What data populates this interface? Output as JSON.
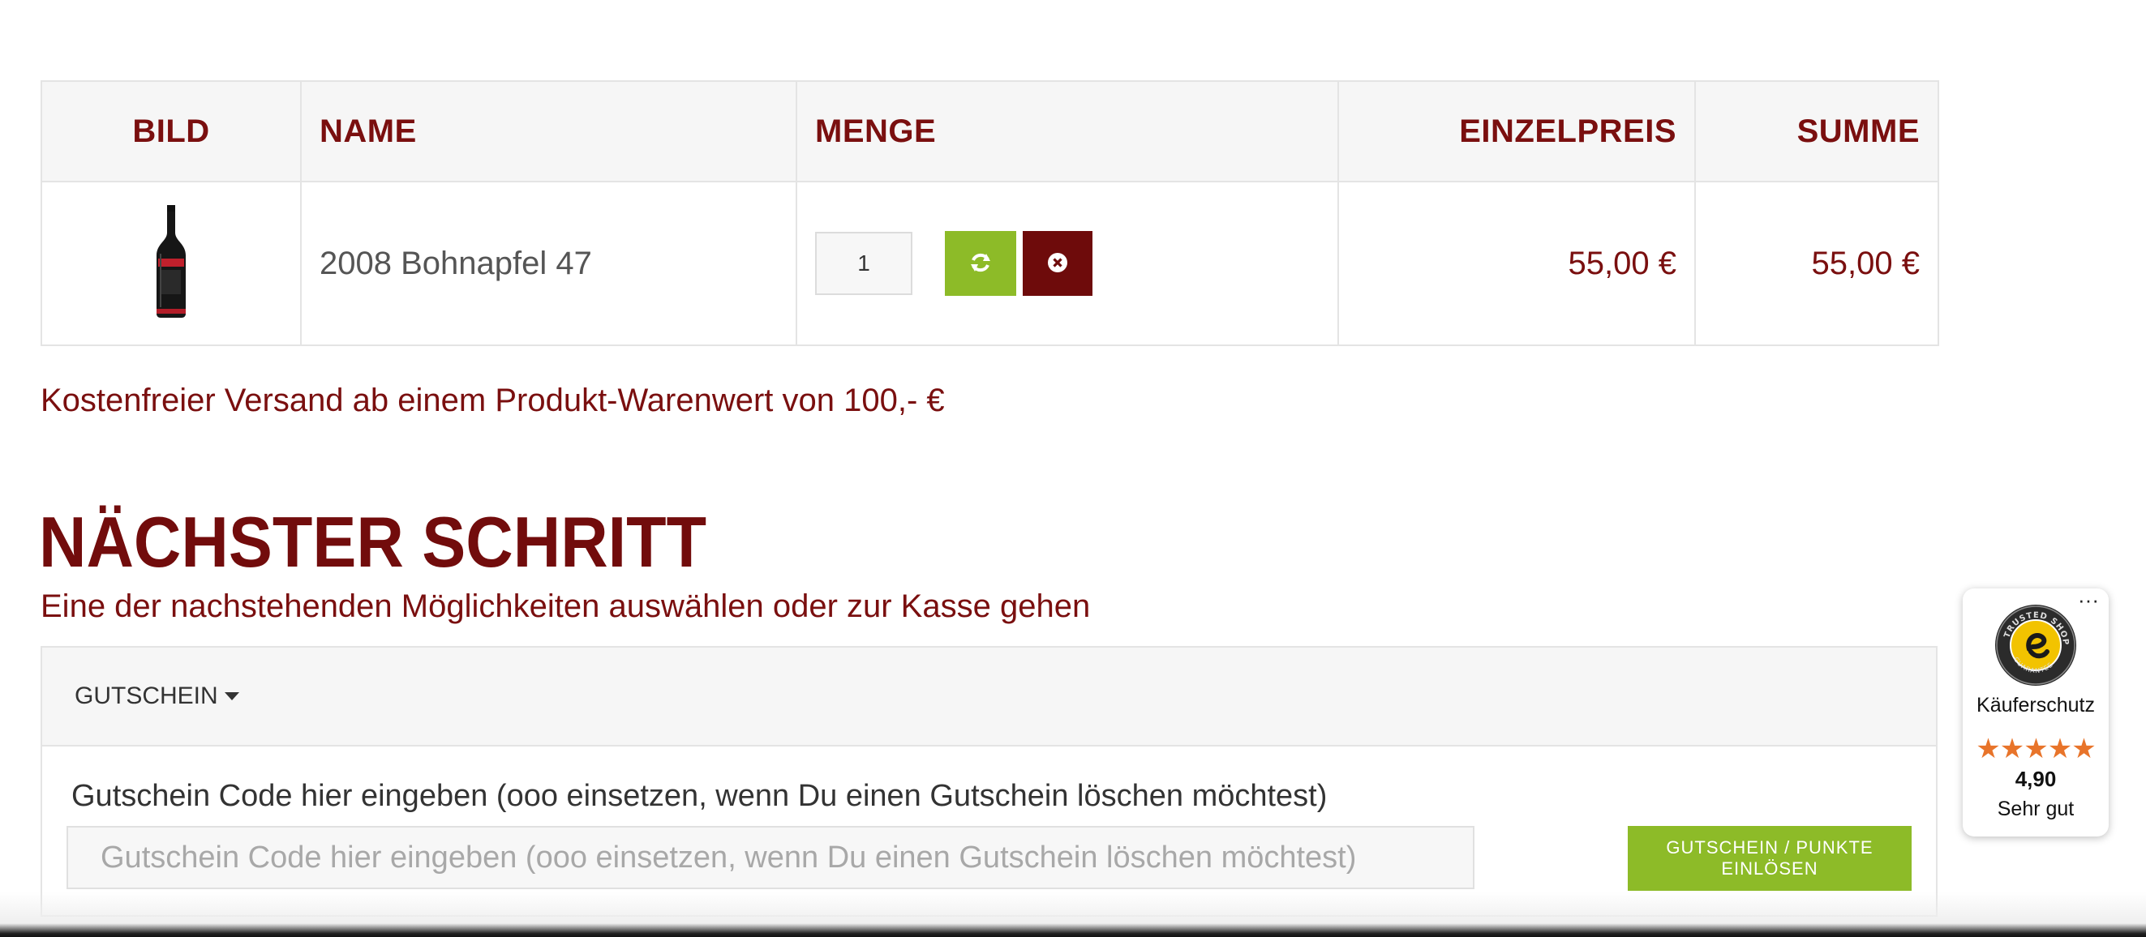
{
  "cart": {
    "headers": {
      "image": "BILD",
      "name": "NAME",
      "quantity": "MENGE",
      "unit_price": "EINZELPREIS",
      "sum": "SUMME"
    },
    "rows": [
      {
        "name": "2008 Bohnapfel 47",
        "quantity": "1",
        "unit_price": "55,00 €",
        "sum": "55,00 €",
        "image_icon": "wine-bottle-icon"
      }
    ]
  },
  "shipping_note": "Kostenfreier Versand ab einem Produkt-Warenwert von 100,- €",
  "next_step": {
    "title": "NÄCHSTER SCHRITT",
    "subtitle": "Eine der nachstehenden Möglichkeiten auswählen oder zur Kasse gehen"
  },
  "voucher": {
    "toggle_label": "GUTSCHEIN",
    "field_label": "Gutschein Code hier eingeben (ooo einsetzen, wenn Du einen Gutschein löschen möchtest)",
    "placeholder": "Gutschein Code hier eingeben (ooo einsetzen, wenn Du einen Gutschein löschen möchtest)",
    "submit_label": "GUTSCHEIN / PUNKTE EINLÖSEN"
  },
  "trusted_shops": {
    "menu": "···",
    "label": "Käuferschutz",
    "stars": "★★★★★",
    "rating": "4,90",
    "verdict": "Sehr gut"
  },
  "colors": {
    "brand_dark_red": "#720c0c",
    "accent_green": "#8dbb28",
    "star_orange": "#e8742a"
  }
}
